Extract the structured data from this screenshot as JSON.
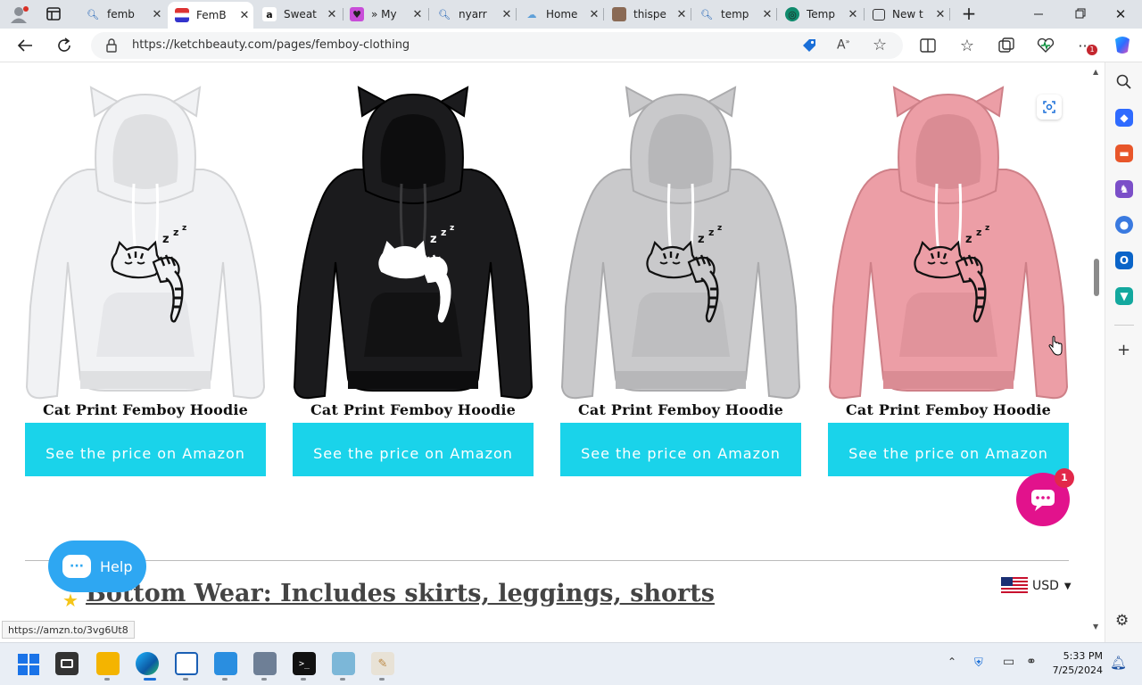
{
  "browser": {
    "profile_icon": "person-icon",
    "tabs": [
      {
        "title": "femb",
        "favicon": "search-icon"
      },
      {
        "title": "FemB",
        "favicon": "ketch-favicon"
      },
      {
        "title": "Sweat",
        "favicon": "amazon-favicon"
      },
      {
        "title": "» My",
        "favicon": "heart-favicon"
      },
      {
        "title": "nyarr",
        "favicon": "search-icon"
      },
      {
        "title": "Home",
        "favicon": "cloud-favicon"
      },
      {
        "title": "thispe",
        "favicon": "photo-favicon"
      },
      {
        "title": "temp",
        "favicon": "search-icon"
      },
      {
        "title": "Temp",
        "favicon": "globe-favicon"
      },
      {
        "title": "New t",
        "favicon": "newtab-favicon"
      }
    ],
    "url": "https://ketchbeauty.com/pages/femboy-clothing",
    "extensions_badge": "1",
    "status_url": "https://amzn.to/3vg6Ut8"
  },
  "products": [
    {
      "title": "Cat Print Femboy Hoodie",
      "button": "See the price on Amazon",
      "color": "#f1f2f4"
    },
    {
      "title": "Cat Print Femboy Hoodie",
      "button": "See the price on Amazon",
      "color": "#1b1b1d"
    },
    {
      "title": "Cat Print Femboy Hoodie",
      "button": "See the price on Amazon",
      "color": "#c9c9cb"
    },
    {
      "title": "Cat Print Femboy Hoodie",
      "button": "See the price on Amazon",
      "color": "#ec9ea6"
    }
  ],
  "section_heading": "Bottom Wear: Includes skirts, leggings, shorts",
  "help_button": "Help",
  "chat_badge": "1",
  "currency": "USD",
  "colors": {
    "accent": "#1ad3ea",
    "help": "#2ea7f2",
    "chat": "#e2128c"
  },
  "taskbar": {
    "time": "5:33 PM",
    "date": "7/25/2024"
  }
}
